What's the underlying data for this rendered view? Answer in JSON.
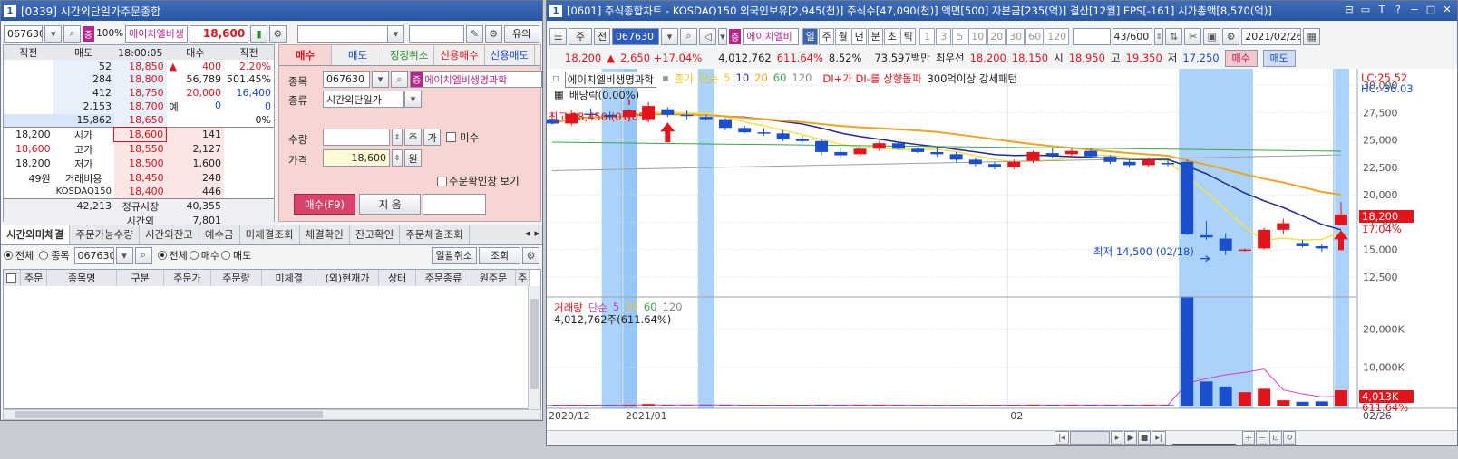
{
  "left": {
    "window_num": "1",
    "title": "[0339] 시간외단일가주문종합",
    "code": "067630",
    "badge": "증",
    "margin": "100%",
    "name": "에이치엘비생",
    "price": "18,600",
    "yui_button": "유의",
    "orderbook": {
      "headers": [
        "직전",
        "매도",
        "18:00:05",
        "매수",
        "직전"
      ],
      "asks": [
        {
          "prevsell": "52",
          "sell": "18,850",
          "chg": "400",
          "rate": "2.20%"
        },
        {
          "prevsell": "284",
          "sell": "18,800",
          "chg": "56,789",
          "rate": "501.45%"
        },
        {
          "prevsell": "412",
          "sell": "18,750",
          "chg": "20,000",
          "rate": "16,400"
        },
        {
          "prevsell": "2,153",
          "sell": "18,700",
          "chg": "예",
          "rate": "0",
          "extra": "0"
        },
        {
          "prevsell": "15,862",
          "sell": "18,650",
          "chg": "",
          "rate": "0%"
        }
      ],
      "bids": [
        {
          "label_val": "18,200",
          "label": "시가",
          "price": "18,600",
          "buy": "141"
        },
        {
          "label_val": "18,600",
          "label": "고가",
          "price": "18,550",
          "buy": "2,127"
        },
        {
          "label_val": "18,200",
          "label": "저가",
          "price": "18,500",
          "buy": "1,600"
        },
        {
          "label_val": "49원",
          "label": "거래비용",
          "price": "18,450",
          "buy": "248"
        },
        {
          "label_val": "",
          "label": "KOSDAQ150",
          "price": "18,400",
          "buy": "446"
        }
      ],
      "totals": {
        "sell_total": "42,213",
        "market": "정규시장",
        "buy_total": "40,355",
        "session": "시간외",
        "session_val": "7,801"
      }
    },
    "order_tabs": [
      "매수",
      "매도",
      "정정취소",
      "신용매수",
      "신용매도"
    ],
    "order_form": {
      "label_item": "종목",
      "item_code": "067630",
      "item_badge": "증",
      "item_name": "에이치엘비생명과학",
      "label_type": "종류",
      "type_value": "시간외단일가",
      "label_qty": "수량",
      "qty_btn1": "주",
      "qty_btn2": "가",
      "misu": "미수",
      "label_price": "가격",
      "price_value": "18,600",
      "price_unit": "원",
      "confirm": "주문확인창 보기",
      "buy_btn": "매수(F9)",
      "clear_btn": "지 움"
    },
    "bottom_tabs": [
      "시간외미체결",
      "주문가능수량",
      "시간외잔고",
      "예수금",
      "미체결조회",
      "체결확인",
      "잔고확인",
      "주문체결조회"
    ],
    "filter": {
      "all": "전체",
      "item": "종목",
      "code": "067630",
      "all2": "전체",
      "buy": "매수",
      "sell": "매도",
      "cancel_all": "일괄취소",
      "query": "조회"
    },
    "grid_headers": [
      "주문",
      "종목명",
      "구분",
      "주문가",
      "주문량",
      "미체결",
      "(외)현재가",
      "상태",
      "주문종류",
      "원주문",
      "주"
    ]
  },
  "right": {
    "window_num": "1",
    "title": "[0601] 주식종합차트 - KOSDAQ150 외국인보유[2,945(천)] 주식수[47,090(천)] 액면[500] 자본금[235(억)] 결산[12월] EPS[-161] 시가총액[8,570(억)]",
    "toolbar": {
      "mode": "주",
      "jeon": "전",
      "code": "067630",
      "badge": "증",
      "name": "에이치엘비",
      "periods": [
        "일",
        "주",
        "월",
        "년",
        "분",
        "초",
        "틱"
      ],
      "minutes": [
        "1",
        "3",
        "5",
        "10",
        "20",
        "30",
        "60",
        "120"
      ],
      "count": "43/600",
      "date": "2021/02/26"
    },
    "quote": {
      "price": "18,200",
      "change": "2,650 +17.04%",
      "volume": "4,012,762",
      "vol_rate": "611.64%",
      "turnover": "8.52%",
      "amount": "73,597백만",
      "best_label": "최우선",
      "best_sell": "18,200",
      "best_buy": "18,150",
      "open_label": "시",
      "open": "18,950",
      "high_label": "고",
      "high": "19,350",
      "low_label": "저",
      "low": "17,250",
      "buy_btn": "매수",
      "sell_btn": "매도"
    },
    "legend": {
      "name": "에이치엘비생명과학",
      "close": "종가",
      "simple": "단순",
      "ma5": "5",
      "ma10": "10",
      "ma20": "20",
      "ma60": "60",
      "ma120": "120",
      "dmi": "DI+가 DI-를 상향돌파",
      "pattern": "300억이상 강세패턴",
      "dividend": "배당락(0.00%)"
    },
    "annotations": {
      "high": "최고 28,450 (01/05)",
      "low": "최저 14,500 (02/18)",
      "lc": "LC:25.52",
      "hc": "HC:-36.03",
      "current": "18,200",
      "current_rate": "17.04%"
    },
    "volume_legend": {
      "label": "거래량",
      "simple": "단순",
      "ma5": "5",
      "ma20": "20",
      "ma60": "60",
      "ma120": "120",
      "value": "4,012,762주(611.64%)",
      "current": "4,013K",
      "current_rate": "611.64%"
    },
    "x_labels": [
      "2020/12",
      "2021/01",
      "02",
      "02/26"
    ],
    "price_ticks": [
      "30,000",
      "27,500",
      "25,000",
      "22,500",
      "20,000",
      "17,500",
      "15,000",
      "12,500"
    ],
    "volume_ticks": [
      "20,000K",
      "10,000K"
    ],
    "colors": {
      "up": "#e3141b",
      "down": "#1a4fcf",
      "ma5": "#f3e24a",
      "ma10": "#1e2a9a",
      "ma20": "#f0a321",
      "ma60": "#39a84a",
      "ma120": "#9aa0a6",
      "highlight": "#8fc3f5"
    }
  },
  "chart_data": {
    "type": "candlestick",
    "dates": [
      "12/24",
      "12/28",
      "12/29",
      "12/30",
      "01/04",
      "01/05",
      "01/06",
      "01/07",
      "01/08",
      "01/11",
      "01/12",
      "01/13",
      "01/14",
      "01/15",
      "01/18",
      "01/19",
      "01/20",
      "01/21",
      "01/22",
      "01/25",
      "01/26",
      "01/27",
      "01/28",
      "01/29",
      "02/01",
      "02/02",
      "02/03",
      "02/04",
      "02/05",
      "02/08",
      "02/09",
      "02/10",
      "02/15",
      "02/16",
      "02/17",
      "02/18",
      "02/19",
      "02/22",
      "02/23",
      "02/24",
      "02/25",
      "02/26"
    ],
    "ohlc": [
      [
        26900,
        27300,
        26400,
        26500
      ],
      [
        26500,
        27700,
        26300,
        27400
      ],
      [
        27400,
        27900,
        27100,
        27300
      ],
      [
        27300,
        27600,
        26800,
        27100
      ],
      [
        27100,
        27800,
        26700,
        27700
      ],
      [
        26900,
        28450,
        26600,
        28100
      ],
      [
        27800,
        28000,
        27100,
        27300
      ],
      [
        27300,
        27700,
        26900,
        27200
      ],
      [
        27100,
        27300,
        26800,
        26900
      ],
      [
        26900,
        27000,
        25900,
        26100
      ],
      [
        26100,
        26300,
        25600,
        25700
      ],
      [
        25700,
        26100,
        25400,
        25600
      ],
      [
        25600,
        25900,
        24900,
        25100
      ],
      [
        25100,
        25400,
        24700,
        24900
      ],
      [
        24900,
        25100,
        23600,
        23900
      ],
      [
        23900,
        24300,
        23300,
        23600
      ],
      [
        23700,
        24400,
        23500,
        24200
      ],
      [
        24200,
        24900,
        24000,
        24700
      ],
      [
        24700,
        24800,
        24100,
        24200
      ],
      [
        24200,
        24300,
        23800,
        23900
      ],
      [
        23900,
        24300,
        23500,
        23700
      ],
      [
        23700,
        23900,
        23000,
        23200
      ],
      [
        23200,
        23400,
        22600,
        22800
      ],
      [
        22800,
        23000,
        22300,
        22500
      ],
      [
        22500,
        23200,
        22300,
        23000
      ],
      [
        23100,
        24000,
        22900,
        23900
      ],
      [
        23800,
        24300,
        23300,
        23600
      ],
      [
        23700,
        24200,
        23400,
        24000
      ],
      [
        24000,
        24200,
        23300,
        23500
      ],
      [
        23500,
        23600,
        22800,
        23000
      ],
      [
        23000,
        23200,
        22500,
        22700
      ],
      [
        22700,
        23400,
        22500,
        23200
      ],
      [
        22900,
        23200,
        22600,
        22800
      ],
      [
        23000,
        23200,
        16300,
        16400
      ],
      [
        16300,
        17600,
        15900,
        16100
      ],
      [
        16000,
        16500,
        14500,
        14900
      ],
      [
        14900,
        15100,
        14800,
        15000
      ],
      [
        15100,
        17000,
        15000,
        16800
      ],
      [
        16800,
        17800,
        16400,
        17400
      ],
      [
        15600,
        15900,
        15200,
        15300
      ],
      [
        15300,
        15500,
        14800,
        15100
      ],
      [
        17250,
        19350,
        17250,
        18200
      ]
    ],
    "volume_k": [
      120,
      130,
      140,
      100,
      180,
      420,
      110,
      100,
      90,
      130,
      120,
      110,
      130,
      140,
      170,
      120,
      150,
      150,
      110,
      100,
      110,
      110,
      140,
      130,
      120,
      210,
      160,
      150,
      150,
      130,
      160,
      180,
      150,
      28500,
      6300,
      5000,
      3500,
      4400,
      1400,
      1000,
      1100,
      4013
    ],
    "ylim": [
      11000,
      31000
    ],
    "volume_ylim": [
      0,
      26000
    ],
    "highlight_dates": [
      "12/30",
      "01/04",
      "01/08",
      "02/16",
      "02/26"
    ]
  }
}
